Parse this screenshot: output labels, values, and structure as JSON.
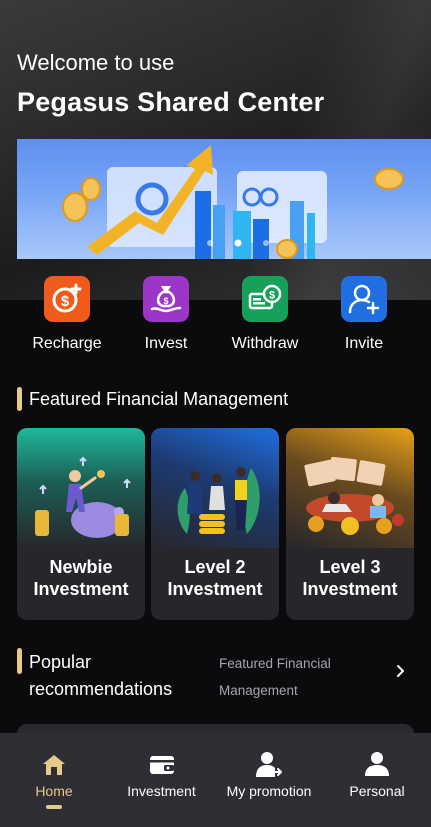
{
  "header": {
    "welcome": "Welcome to use",
    "title": "Pegasus Shared Center"
  },
  "banner": {
    "slide_count": 3,
    "active_slide": 2
  },
  "quick_actions": [
    {
      "label": "Recharge",
      "icon": "recharge-icon",
      "color": "#f05a1a"
    },
    {
      "label": "Invest",
      "icon": "invest-bag-icon",
      "color": "#9b36c9"
    },
    {
      "label": "Withdraw",
      "icon": "withdraw-cash-icon",
      "color": "#17a05a"
    },
    {
      "label": "Invite",
      "icon": "invite-user-icon",
      "color": "#1f6fe0"
    }
  ],
  "featured": {
    "title": "Featured Financial Management",
    "cards": [
      {
        "line1": "Newbie",
        "line2": "Investment",
        "accent": "#1fb89a"
      },
      {
        "line1": "Level 2",
        "line2": "Investment",
        "accent": "#1f6fe0"
      },
      {
        "line1": "Level 3",
        "line2": "Investment",
        "accent": "#e7a21a"
      }
    ]
  },
  "popular": {
    "title_line1": "Popular",
    "title_line2": "recommendations",
    "sub_line1": "Featured Financial",
    "sub_line2": "Management"
  },
  "bottom_nav": [
    {
      "label": "Home",
      "icon": "home-icon",
      "active": true
    },
    {
      "label": "Investment",
      "icon": "wallet-icon",
      "active": false
    },
    {
      "label": "My promotion",
      "icon": "promotion-user-icon",
      "active": false
    },
    {
      "label": "Personal",
      "icon": "person-icon",
      "active": false
    }
  ],
  "colors": {
    "accent_gold": "#e8c98a",
    "background": "#0b0b0e",
    "nav_background": "#2e2e34"
  }
}
